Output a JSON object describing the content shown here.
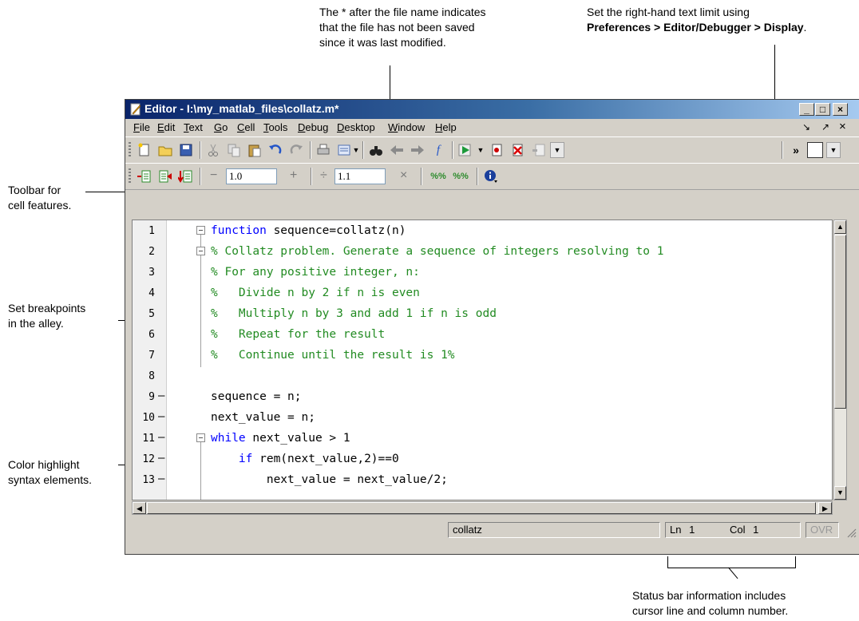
{
  "annotations": {
    "title_note": [
      "The * after the file name indicates",
      "that the file has not been saved",
      "since it was last modified."
    ],
    "limit_note": {
      "line1": "Set the right-hand text limit using",
      "line2": "Preferences > Editor/Debugger > Display",
      "line2_suffix": "."
    },
    "toolbar_note": [
      "Toolbar for",
      "cell features."
    ],
    "breakpoint_note": [
      "Set breakpoints",
      "in the alley."
    ],
    "syntax_note": [
      "Color highlight",
      "syntax elements."
    ],
    "status_note": [
      "Status bar information includes",
      "cursor line and column number."
    ]
  },
  "window": {
    "title": "Editor - I:\\my_matlab_files\\collatz.m*",
    "buttons": {
      "minimize": "_",
      "maximize": "□",
      "close": "×"
    }
  },
  "menubar": {
    "items": [
      "File",
      "Edit",
      "Text",
      "Go",
      "Cell",
      "Tools",
      "Debug",
      "Desktop",
      "Window",
      "Help"
    ],
    "dock_glyph": "↘",
    "undock_glyph": "↗",
    "close_glyph": "×"
  },
  "cell_toolbar": {
    "decrement_glyph": "−",
    "increment_value": "1.0",
    "increment_glyph": "+",
    "divide_glyph": "÷",
    "multiply_value": "1.1",
    "multiply_glyph": "×",
    "cell_glyph_a": "%%",
    "cell_glyph_b": "%%"
  },
  "toolbar": {
    "overflow_glyph": "»"
  },
  "code": {
    "lines": [
      {
        "num": "1",
        "bp": "",
        "fold": true,
        "parts": [
          {
            "t": "function",
            "c": "kw"
          },
          {
            "t": " sequence=collatz(n)",
            "c": ""
          }
        ]
      },
      {
        "num": "2",
        "bp": "",
        "fold": true,
        "parts": [
          {
            "t": "% Collatz problem. Generate a sequence of integers resolving to 1",
            "c": "cm"
          }
        ]
      },
      {
        "num": "3",
        "bp": "",
        "fold": false,
        "parts": [
          {
            "t": "% For any positive integer, n:",
            "c": "cm"
          }
        ]
      },
      {
        "num": "4",
        "bp": "",
        "fold": false,
        "parts": [
          {
            "t": "%   Divide n by 2 if n is even",
            "c": "cm"
          }
        ]
      },
      {
        "num": "5",
        "bp": "",
        "fold": false,
        "parts": [
          {
            "t": "%   Multiply n by 3 and add 1 if n is odd",
            "c": "cm"
          }
        ]
      },
      {
        "num": "6",
        "bp": "",
        "fold": false,
        "parts": [
          {
            "t": "%   Repeat for the result",
            "c": "cm"
          }
        ]
      },
      {
        "num": "7",
        "bp": "",
        "fold": false,
        "parts": [
          {
            "t": "%   Continue until the result is 1%",
            "c": "cm"
          }
        ]
      },
      {
        "num": "8",
        "bp": "",
        "fold": false,
        "parts": [
          {
            "t": "",
            "c": ""
          }
        ]
      },
      {
        "num": "9",
        "bp": "–",
        "fold": false,
        "parts": [
          {
            "t": "sequence = n;",
            "c": ""
          }
        ]
      },
      {
        "num": "10",
        "bp": "–",
        "fold": false,
        "parts": [
          {
            "t": "next_value = n;",
            "c": ""
          }
        ]
      },
      {
        "num": "11",
        "bp": "–",
        "fold": true,
        "parts": [
          {
            "t": "while",
            "c": "kw"
          },
          {
            "t": " next_value > 1",
            "c": ""
          }
        ]
      },
      {
        "num": "12",
        "bp": "–",
        "fold": false,
        "parts": [
          {
            "t": "    ",
            "c": ""
          },
          {
            "t": "if",
            "c": "kw"
          },
          {
            "t": " rem(next_value,2)==0",
            "c": ""
          }
        ]
      },
      {
        "num": "13",
        "bp": "–",
        "fold": false,
        "parts": [
          {
            "t": "        next_value = next_value/2;",
            "c": ""
          }
        ]
      }
    ]
  },
  "status": {
    "function_name": "collatz",
    "ln_label": "Ln",
    "ln_value": "1",
    "col_label": "Col",
    "col_value": "1",
    "mode": "OVR"
  }
}
